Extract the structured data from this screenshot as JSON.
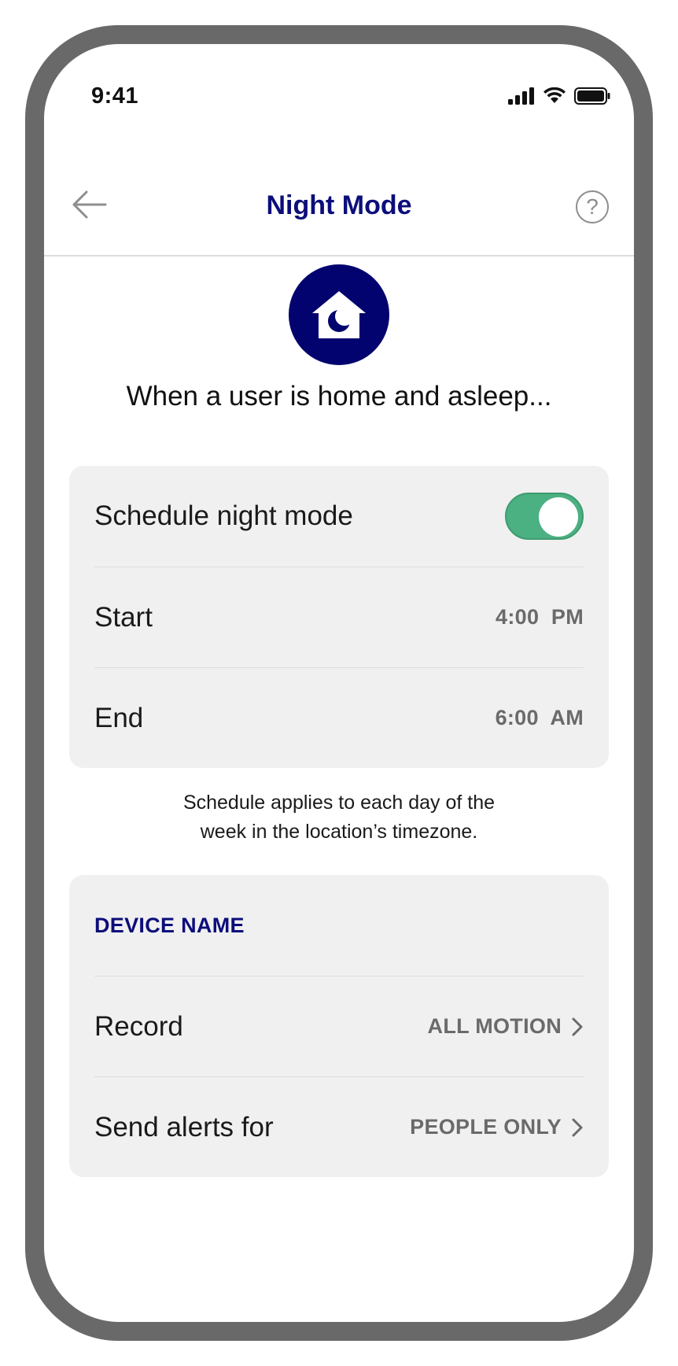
{
  "status_bar": {
    "time": "9:41",
    "icons": [
      "cellular-signal-icon",
      "wifi-icon",
      "battery-icon"
    ]
  },
  "header": {
    "title": "Night Mode",
    "back_icon": "arrow-left-icon",
    "help_label": "?"
  },
  "hero": {
    "icon": "house-moon-icon",
    "intro_text": "When a user is home and asleep..."
  },
  "schedule": {
    "toggle_label": "Schedule night mode",
    "toggle_on": true,
    "start_label": "Start",
    "start_value": "4:00  PM",
    "end_label": "End",
    "end_value": "6:00  AM"
  },
  "note": {
    "line1": "Schedule applies to each day of the",
    "line2": "week in the location’s timezone."
  },
  "device": {
    "section_title": "DEVICE NAME",
    "record_label": "Record",
    "record_value": "ALL MOTION",
    "alerts_label": "Send alerts for",
    "alerts_value": "PEOPLE ONLY"
  },
  "colors": {
    "brand_navy": "#0c0e7a",
    "toggle_green": "#4bb082",
    "frame_gray": "#696969",
    "card_bg": "#f0f0f0"
  }
}
